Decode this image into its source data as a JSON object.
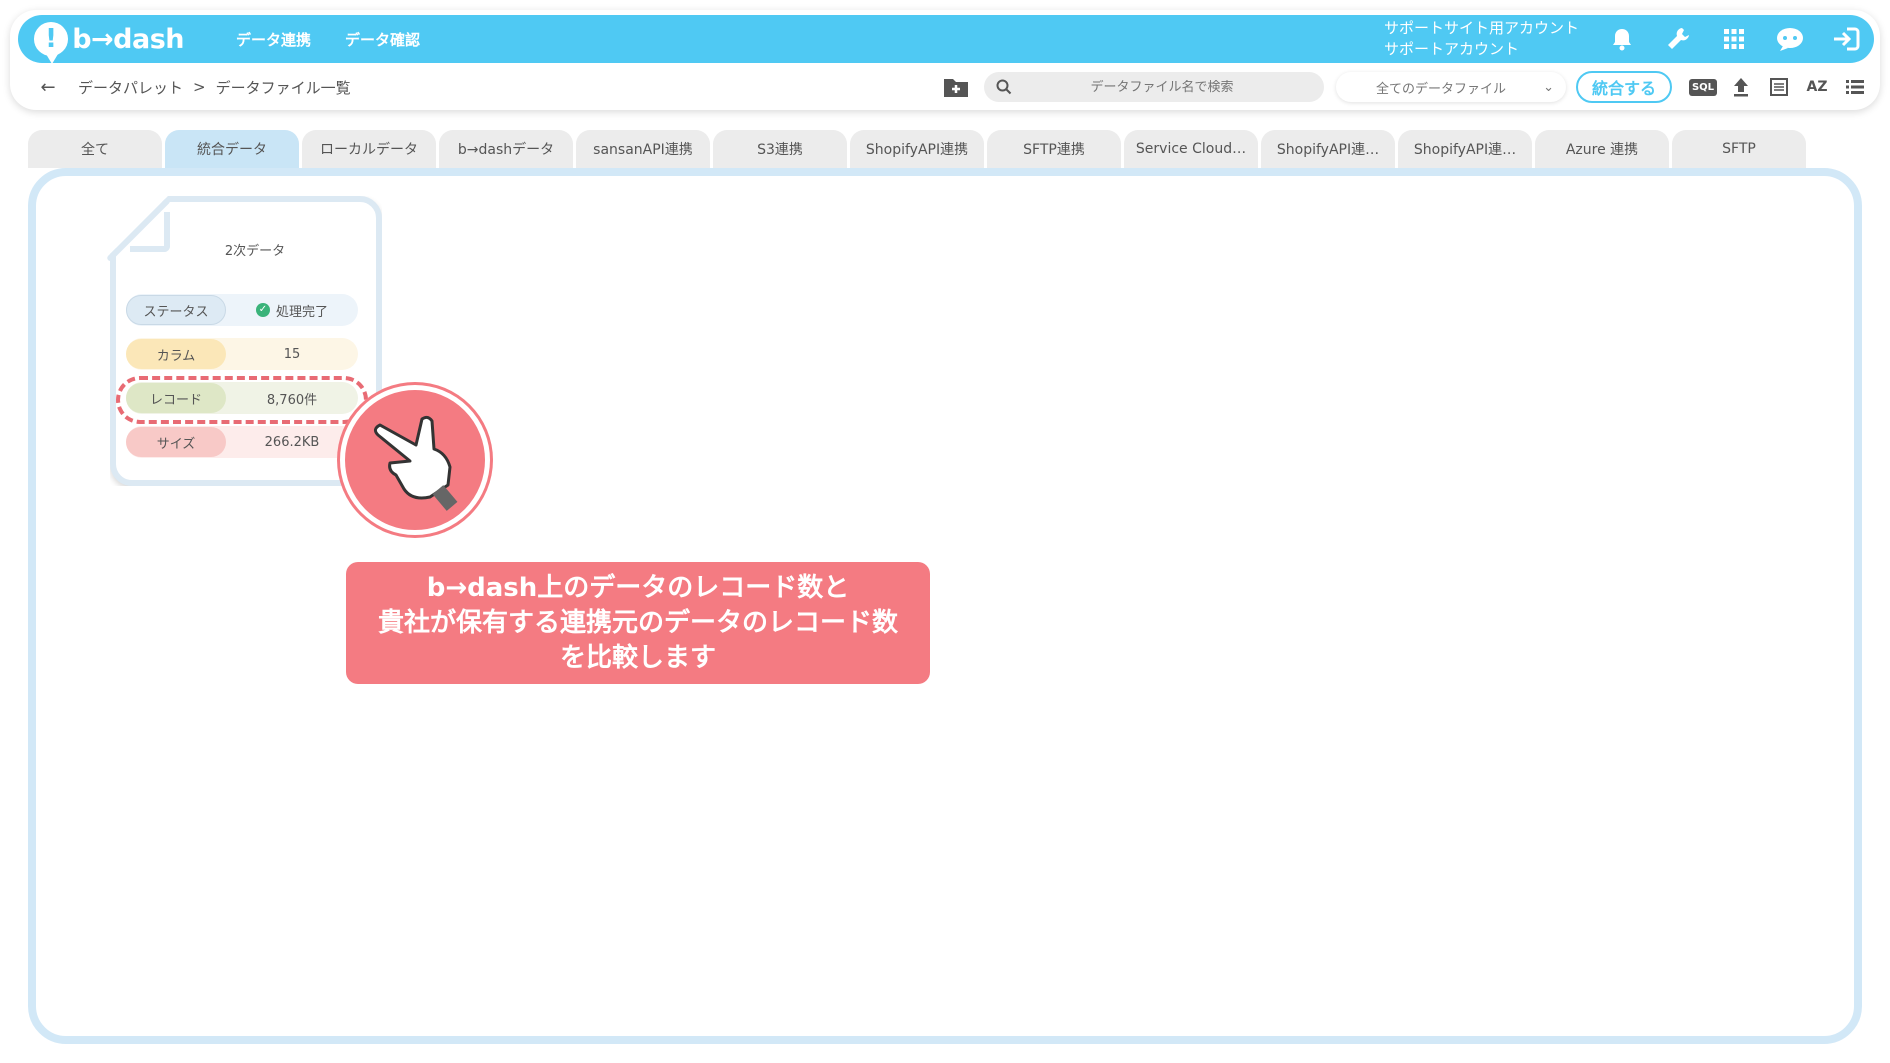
{
  "app": {
    "logo_text": "b→dash",
    "nav": [
      "データ連携",
      "データ確認"
    ],
    "account_line1": "サポートサイト用アカウント",
    "account_line2": "サポートアカウント"
  },
  "breadcrumb": {
    "parent": "データパレット",
    "separator": ">",
    "current": "データファイル一覧"
  },
  "toolbar": {
    "search_placeholder": "データファイル名で検索",
    "filter_selected": "全てのデータファイル",
    "merge_label": "統合する",
    "sql_label": "SQL",
    "sort_label": "AZ"
  },
  "tabs": [
    {
      "label": "全て"
    },
    {
      "label": "統合データ"
    },
    {
      "label": "ローカルデータ"
    },
    {
      "label": "b→dashデータ"
    },
    {
      "label": "sansanAPI連携"
    },
    {
      "label": "S3連携"
    },
    {
      "label": "ShopifyAPI連携"
    },
    {
      "label": "SFTP連携"
    },
    {
      "label": "Service Cloud…"
    },
    {
      "label": "ShopifyAPI連…"
    },
    {
      "label": "ShopifyAPI連…"
    },
    {
      "label": "Azure 連携"
    },
    {
      "label": "SFTP"
    }
  ],
  "active_tab_index": 1,
  "card": {
    "title": "2次データ",
    "status_label": "ステータス",
    "status_value": "処理完了",
    "column_label": "カラム",
    "column_value": "15",
    "record_label": "レコード",
    "record_value": "8,760件",
    "size_label": "サイズ",
    "size_value": "266.2KB"
  },
  "callout": {
    "line1": "b→dash上のデータのレコード数と",
    "line2": "貴社が保有する連携元のデータのレコード数",
    "line3": "を比較します"
  },
  "colors": {
    "header": "#4fc9f3",
    "accent_pink": "#f47b82",
    "active_tab": "#c9e5f6",
    "status_ok": "#3ab37a"
  }
}
